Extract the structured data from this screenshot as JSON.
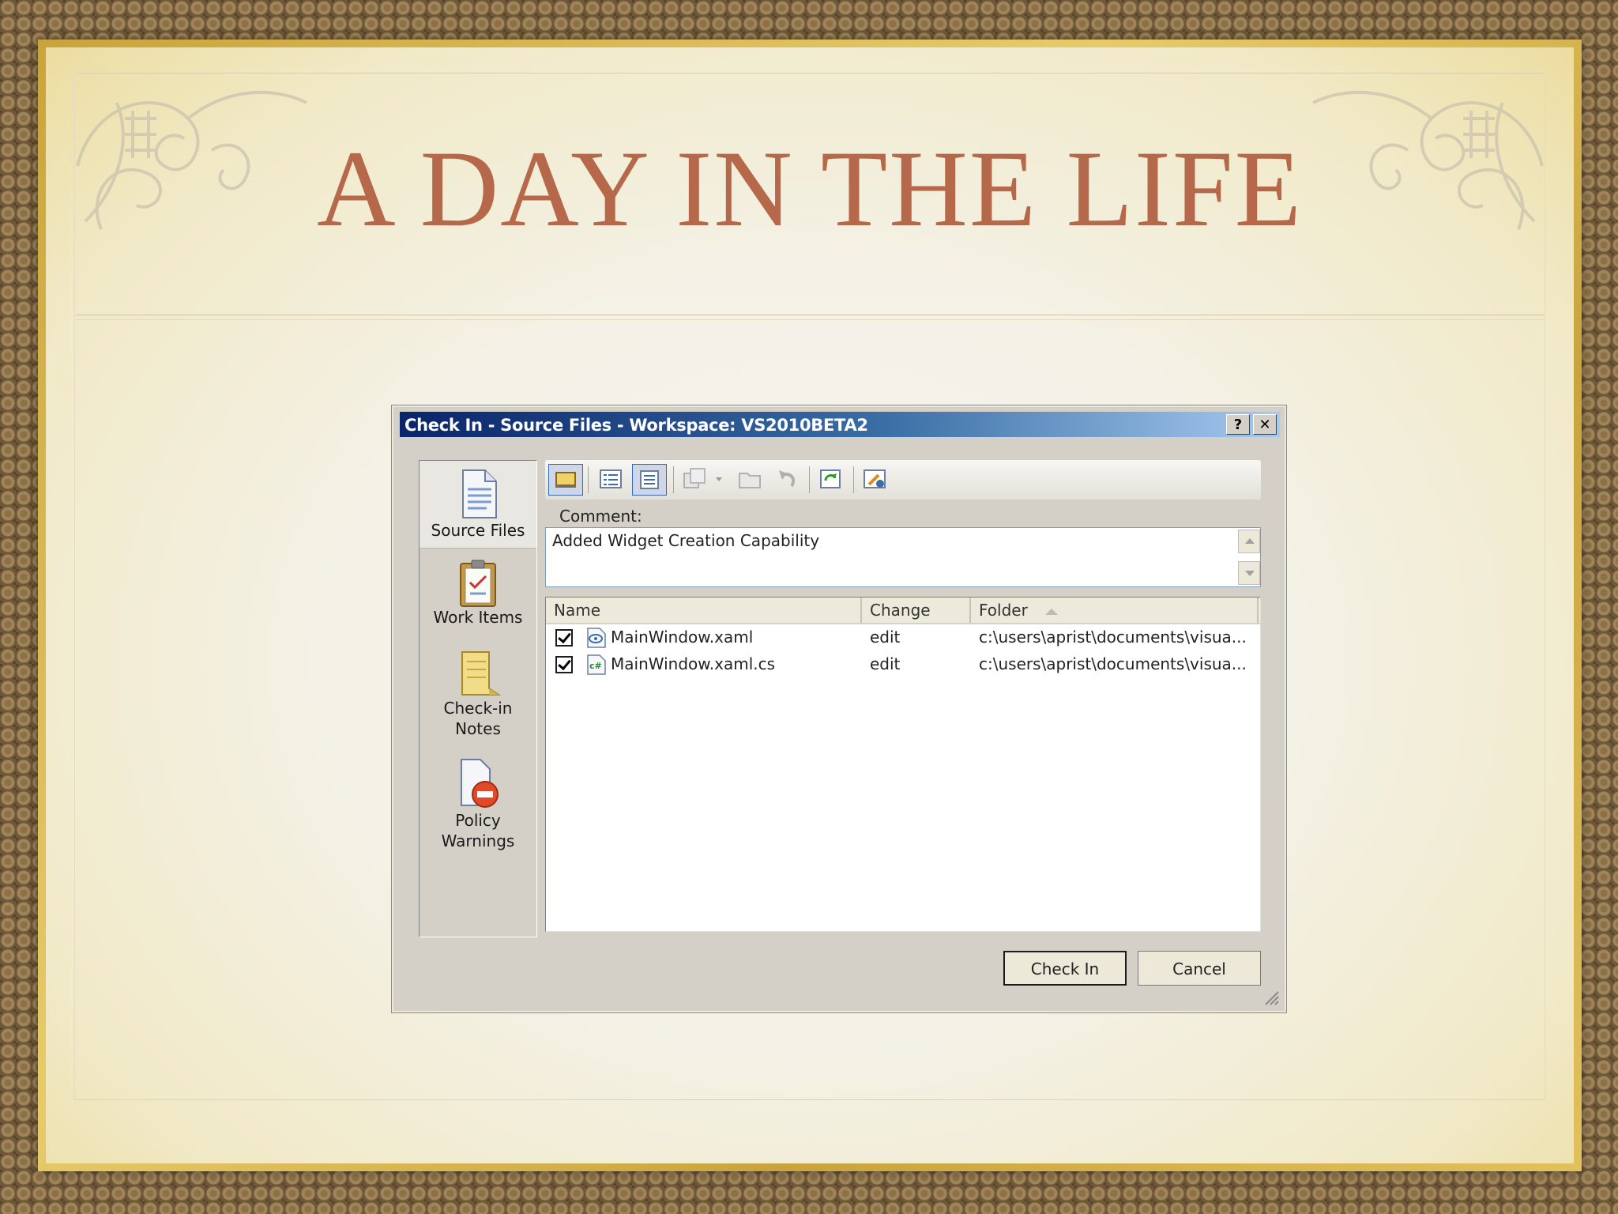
{
  "slide": {
    "title": "A DAY IN THE LIFE"
  },
  "dialog": {
    "title": "Check In - Source Files - Workspace: VS2010BETA2",
    "help_label": "?",
    "close_label": "✕",
    "nav": [
      {
        "label": "Source Files",
        "icon": "document-icon",
        "selected": true
      },
      {
        "label": "Work Items",
        "icon": "clipboard-icon",
        "selected": false
      },
      {
        "label": "Check-in Notes",
        "icon": "notes-icon",
        "selected": false
      },
      {
        "label": "Policy Warnings",
        "icon": "policy-warning-icon",
        "selected": false
      }
    ],
    "comment_label": "Comment:",
    "comment_value": "Added Widget Creation Capability",
    "columns": [
      "Name",
      "Change",
      "Folder"
    ],
    "files": [
      {
        "checked": true,
        "icon": "xaml-file-icon",
        "name": "MainWindow.xaml",
        "change": "edit",
        "folder": "c:\\users\\aprist\\documents\\visua..."
      },
      {
        "checked": true,
        "icon": "csharp-file-icon",
        "name": "MainWindow.xaml.cs",
        "change": "edit",
        "folder": "c:\\users\\aprist\\documents\\visua..."
      }
    ],
    "check_in_label": "Check In",
    "cancel_label": "Cancel",
    "colors": {
      "title_gradient_start": "#0a246a",
      "slide_title": "#b5694a"
    }
  }
}
